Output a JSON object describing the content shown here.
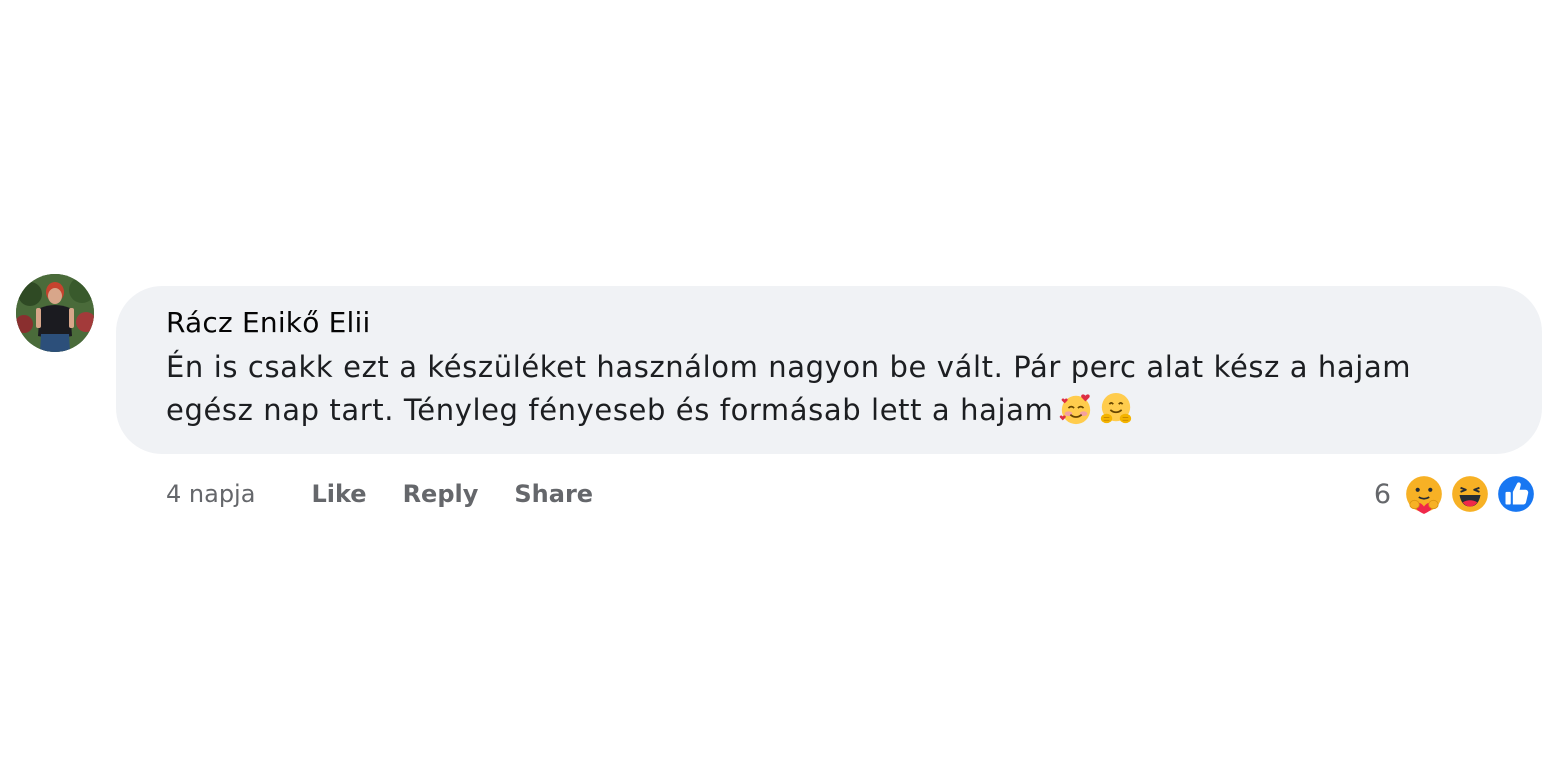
{
  "comment": {
    "author": "Rácz Enikő Elii",
    "text": "Én is csakk ezt a készüléket használom nagyon be vált. Pár perc alat kész a hajam egész nap tart. Tényleg fényeseb és formásab lett a hajam",
    "emojis": [
      "smiling-face-with-hearts-icon",
      "hugging-face-icon"
    ],
    "time": "4 napja",
    "actions": {
      "like": "Like",
      "reply": "Reply",
      "share": "Share"
    },
    "reactions": {
      "count": "6",
      "icons": [
        "care-reaction-icon",
        "haha-reaction-icon",
        "like-reaction-icon"
      ]
    }
  },
  "colors": {
    "bubble": "#f0f2f5",
    "secondary_text": "#65676b",
    "like_blue": "#1877f2"
  }
}
